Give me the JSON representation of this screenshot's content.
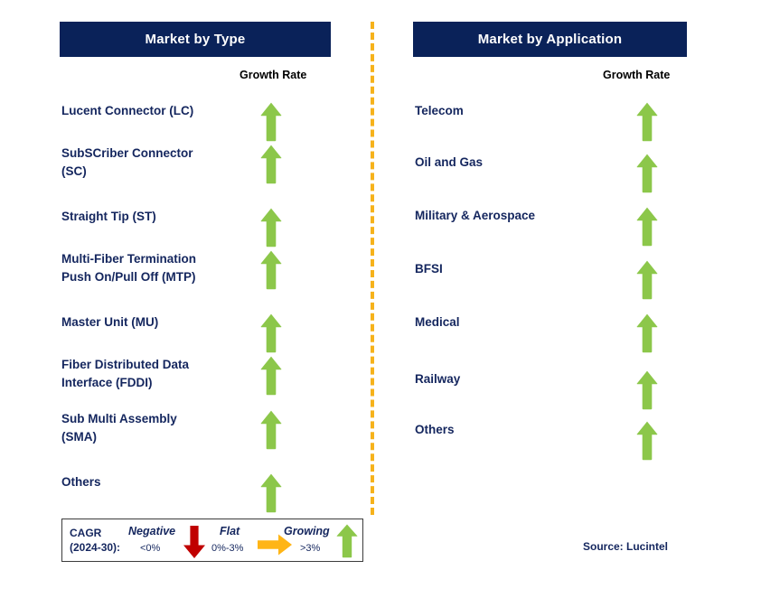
{
  "colors": {
    "header_bg": "#0A2259",
    "label_text": "#14265E",
    "arrow_green": "#8CC74A",
    "arrow_red": "#C00000",
    "arrow_orange": "#FFB516",
    "divider": "#F6B21B",
    "legend_border": "#3c3c3c",
    "growth_caption": "#000000"
  },
  "left_panel": {
    "header": "Market by Type",
    "growth_caption": "Growth Rate",
    "items": [
      {
        "label": "Lucent Connector (LC)",
        "growth": "growing",
        "icon": "arrow-up-icon"
      },
      {
        "label": "SubSCriber Connector\n(SC)",
        "growth": "growing",
        "icon": "arrow-up-icon"
      },
      {
        "label": "Straight Tip (ST)",
        "growth": "growing",
        "icon": "arrow-up-icon"
      },
      {
        "label": "Multi-Fiber Termination\nPush On/Pull Off (MTP)",
        "growth": "growing",
        "icon": "arrow-up-icon"
      },
      {
        "label": "Master Unit (MU)",
        "growth": "growing",
        "icon": "arrow-up-icon"
      },
      {
        "label": "Fiber Distributed Data\nInterface (FDDI)",
        "growth": "growing",
        "icon": "arrow-up-icon"
      },
      {
        "label": "Sub Multi Assembly\n(SMA)",
        "growth": "growing",
        "icon": "arrow-up-icon"
      },
      {
        "label": "Others",
        "growth": "growing",
        "icon": "arrow-up-icon"
      }
    ]
  },
  "right_panel": {
    "header": "Market by Application",
    "growth_caption": "Growth Rate",
    "items": [
      {
        "label": "Telecom",
        "growth": "growing",
        "icon": "arrow-up-icon"
      },
      {
        "label": "Oil and Gas",
        "growth": "growing",
        "icon": "arrow-up-icon"
      },
      {
        "label": "Military & Aerospace",
        "growth": "growing",
        "icon": "arrow-up-icon"
      },
      {
        "label": "BFSI",
        "growth": "growing",
        "icon": "arrow-up-icon"
      },
      {
        "label": "Medical",
        "growth": "growing",
        "icon": "arrow-up-icon"
      },
      {
        "label": "Railway",
        "growth": "growing",
        "icon": "arrow-up-icon"
      },
      {
        "label": "Others",
        "growth": "growing",
        "icon": "arrow-up-icon"
      }
    ]
  },
  "legend": {
    "title": "CAGR\n(2024-30):",
    "entries": [
      {
        "term": "Negative",
        "value": "<0%",
        "icon": "arrow-down-icon",
        "color": "#C00000"
      },
      {
        "term": "Flat",
        "value": "0%-3%",
        "icon": "arrow-right-icon",
        "color": "#FFB516"
      },
      {
        "term": "Growing",
        "value": ">3%",
        "icon": "arrow-up-icon",
        "color": "#8CC74A"
      }
    ]
  },
  "source": "Source: Lucintel",
  "chart_data": {
    "type": "table",
    "title": "Fiber Optic Connector Market Growth Rate by Segment",
    "legend_scale": {
      "metric": "CAGR (2024-30)",
      "bands": [
        {
          "name": "Negative",
          "range": "<0%"
        },
        {
          "name": "Flat",
          "range": "0%-3%"
        },
        {
          "name": "Growing",
          "range": ">3%"
        }
      ]
    },
    "panels": [
      {
        "name": "Market by Type",
        "value_column": "Growth Rate",
        "categories": [
          "Lucent Connector (LC)",
          "SubSCriber Connector (SC)",
          "Straight Tip (ST)",
          "Multi-Fiber Termination Push On/Pull Off (MTP)",
          "Master Unit (MU)",
          "Fiber Distributed Data Interface (FDDI)",
          "Sub Multi Assembly (SMA)",
          "Others"
        ],
        "values": [
          "Growing",
          "Growing",
          "Growing",
          "Growing",
          "Growing",
          "Growing",
          "Growing",
          "Growing"
        ]
      },
      {
        "name": "Market by Application",
        "value_column": "Growth Rate",
        "categories": [
          "Telecom",
          "Oil and Gas",
          "Military & Aerospace",
          "BFSI",
          "Medical",
          "Railway",
          "Others"
        ],
        "values": [
          "Growing",
          "Growing",
          "Growing",
          "Growing",
          "Growing",
          "Growing",
          "Growing"
        ]
      }
    ]
  }
}
